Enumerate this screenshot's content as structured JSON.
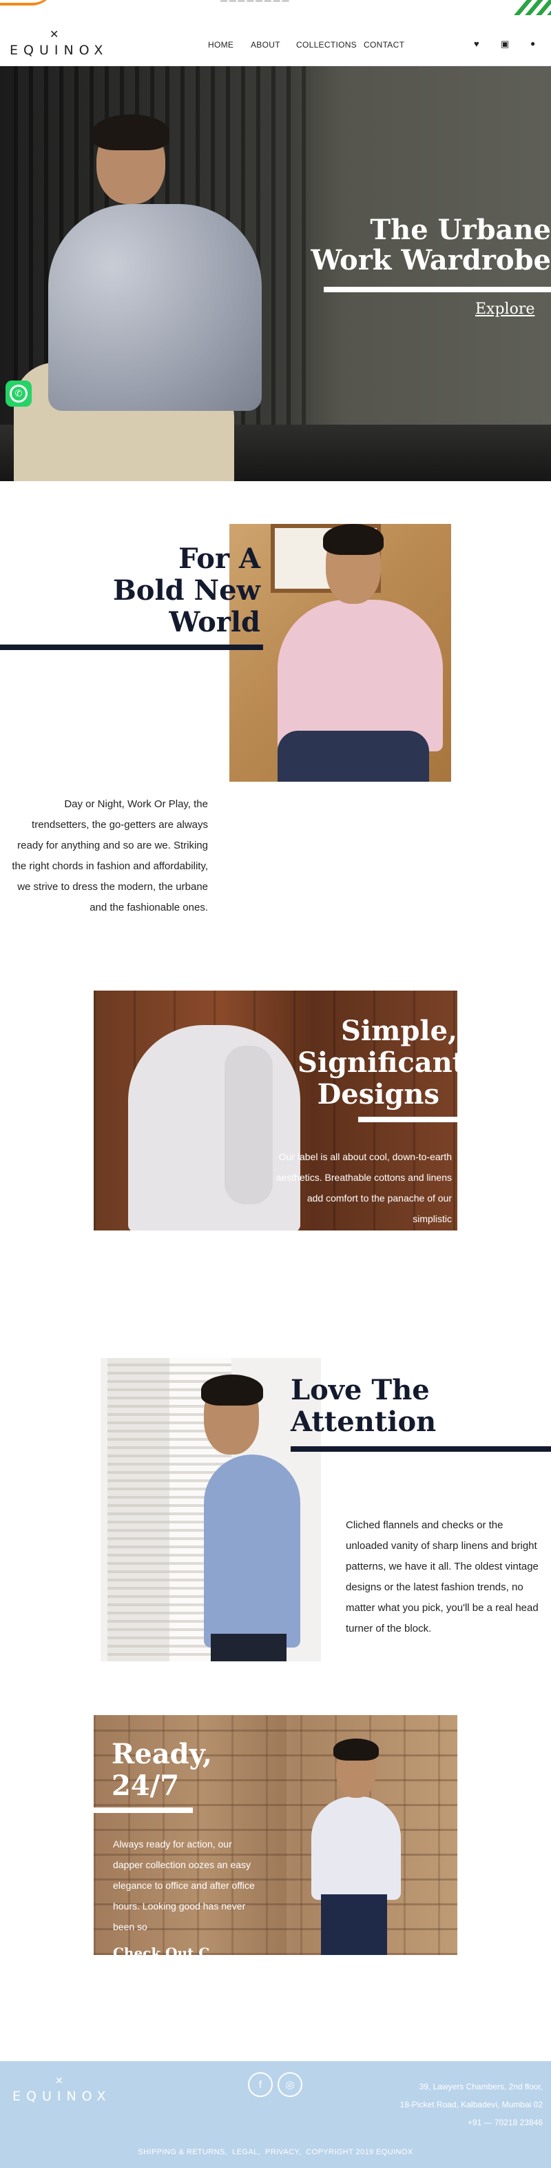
{
  "topbar": {
    "ticker": "— — — — — — — —"
  },
  "header": {
    "logo_mark": "✕",
    "logo_text": "EQUINOX",
    "nav": [
      {
        "label": "HOME"
      },
      {
        "label": "ABOUT"
      },
      {
        "label": "COLLECTIONS"
      },
      {
        "label": "CONTACT"
      }
    ],
    "icons": [
      "heart-icon",
      "bag-icon",
      "user-icon"
    ]
  },
  "hero": {
    "title_line1": "The Urbane",
    "title_line2": "Work Wardrobe",
    "cta": "Explore",
    "whatsapp_icon": "whatsapp-icon"
  },
  "section1": {
    "title_line1": "For A",
    "title_line2": "Bold New",
    "title_line3": "World",
    "text": "Day or Night, Work Or Play, the trendsetters, the go-getters are always ready for anything and so are we. Striking the right chords in fashion and affordability, we strive to dress the modern, the urbane and the fashionable ones."
  },
  "section2": {
    "title_line1": "Simple,",
    "title_line2": "Significant",
    "title_line3": "Designs",
    "text": "Our label is all about cool, down-to-earth aesthetics. Breathable cottons and linens add comfort to the panache of our simplistic"
  },
  "section3": {
    "title_line1": "Love The",
    "title_line2": "Attention",
    "text": "Cliched flannels and checks or the unloaded vanity of sharp linens and bright patterns, we have it all. The oldest vintage designs or the latest fashion trends, no matter what you pick, you'll be a real head turner of the block."
  },
  "section4": {
    "title_line1": "Ready,",
    "title_line2": "24/7",
    "text": "Always ready for action, our dapper collection oozes an easy elegance to office and after office hours. Looking good has never been so",
    "sub": "Check Out C..."
  },
  "footer": {
    "logo_mark": "✕",
    "logo_text": "EQUINOX",
    "social": [
      {
        "icon": "facebook-icon",
        "glyph": "f"
      },
      {
        "icon": "instagram-icon",
        "glyph": "◎"
      }
    ],
    "address_line1": "39, Lawyers Chambers, 2nd floor,",
    "address_line2": "18-Picket Road, Kalbadevi, Mumbai 02",
    "phone": "+91 — 70218 23846",
    "links": [
      "SHIPPING & RETURNS,",
      "LEGAL,",
      "PRIVACY,",
      "COPYRIGHT 2019 EQUINOX"
    ]
  },
  "colors": {
    "navy": "#141a2e",
    "footer_bg": "#b9d3ea",
    "whatsapp": "#25d366",
    "accent_orange": "#f08b1d",
    "accent_green": "#2aa442"
  }
}
